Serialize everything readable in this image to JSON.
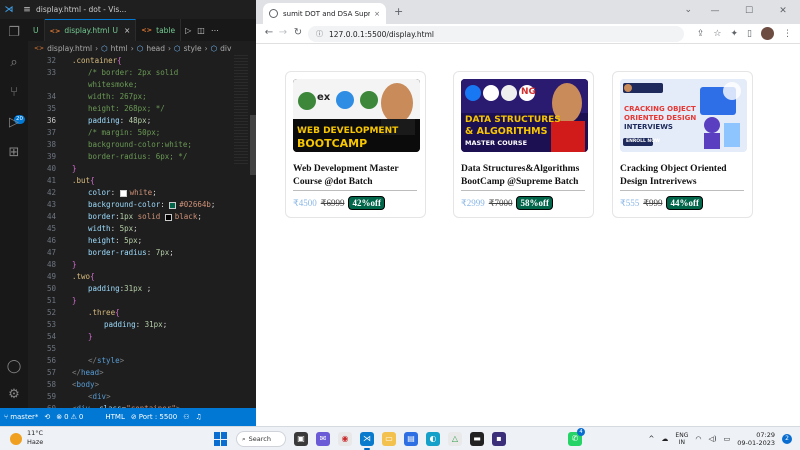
{
  "vscode": {
    "title": "display.html - dot - Vis...",
    "tabs": [
      {
        "label": "U",
        "active": false
      },
      {
        "label": "display.html",
        "modified": "U",
        "active": true
      },
      {
        "label": "table",
        "active": false
      }
    ],
    "breadcrumb": [
      "display.html",
      "html",
      "head",
      "style",
      "div"
    ],
    "activity_badge": "20",
    "code_lines": [
      {
        "n": "32",
        "text": ".container{"
      },
      {
        "n": "33",
        "text": "/* border: 2px solid"
      },
      {
        "n": "",
        "text": "whitesmoke;"
      },
      {
        "n": "34",
        "text": "width: 267px;"
      },
      {
        "n": "35",
        "text": "height: 268px; */"
      },
      {
        "n": "36",
        "text": "padding: 48px;"
      },
      {
        "n": "37",
        "text": "/* margin: 50px;"
      },
      {
        "n": "38",
        "text": "background-color:white;"
      },
      {
        "n": "39",
        "text": "border-radius: 6px; */"
      },
      {
        "n": "40",
        "text": "}"
      },
      {
        "n": "41",
        "text": ".but{"
      },
      {
        "n": "42",
        "text": "color: white;"
      },
      {
        "n": "43",
        "text": "background-color: #02664b;"
      },
      {
        "n": "44",
        "text": "border:1px solid black;"
      },
      {
        "n": "45",
        "text": "width: 5px;"
      },
      {
        "n": "46",
        "text": "height: 5px;"
      },
      {
        "n": "47",
        "text": "border-radius: 7px;"
      },
      {
        "n": "48",
        "text": "}"
      },
      {
        "n": "49",
        "text": ".two{"
      },
      {
        "n": "50",
        "text": "padding:31px ;"
      },
      {
        "n": "51",
        "text": "}"
      },
      {
        "n": "52",
        "text": ".three{"
      },
      {
        "n": "53",
        "text": "padding: 31px;"
      },
      {
        "n": "54",
        "text": "}"
      },
      {
        "n": "55",
        "text": ""
      },
      {
        "n": "56",
        "text": "</style>"
      },
      {
        "n": "57",
        "text": "</head>"
      },
      {
        "n": "58",
        "text": "<body>"
      },
      {
        "n": "59",
        "text": "<div>"
      },
      {
        "n": "60",
        "text": "<div  class=\"container\">"
      }
    ],
    "status": {
      "branch": "master*",
      "errors": "0",
      "warnings": "0",
      "language": "HTML",
      "port": "Port : 5500"
    }
  },
  "browser": {
    "tab_title": "sumit DOT and DSA Supreme C",
    "url": "127.0.0.1:5500/display.html",
    "cards": [
      {
        "title": "Web Development Master Course @dot Batch",
        "price": "₹4500",
        "old_price": "₹6999",
        "discount": "42%off",
        "thumb_line1": "WEB DEVELOPMENT",
        "thumb_line2": "BOOTCAMP",
        "thumb_logo": "ex"
      },
      {
        "title": "Data Structures&Algorithms BootCamp @Supreme Batch",
        "price": "₹2999",
        "old_price": "₹7000",
        "discount": "58%off",
        "thumb_line1": "DATA STRUCTURES",
        "thumb_line2": "& ALGORITHMS",
        "thumb_line3": "MASTER COURSE",
        "thumb_logo": "NG"
      },
      {
        "title": "Cracking Object Oriented Design Intrerivews",
        "price": "₹555",
        "old_price": "₹999",
        "discount": "44%off",
        "thumb_line1": "CRACKING OBJECT",
        "thumb_line2": "ORIENTED DESIGN",
        "thumb_line3": "INTERVIEWS",
        "thumb_button": "ENROLL NOW"
      }
    ]
  },
  "taskbar": {
    "weather_temp": "11°C",
    "weather_desc": "Haze",
    "search_label": "Search",
    "whatsapp_badge": "4",
    "lang_line1": "ENG",
    "lang_line2": "IN",
    "time": "07:29",
    "date": "09-01-2023",
    "notifications": "2"
  }
}
